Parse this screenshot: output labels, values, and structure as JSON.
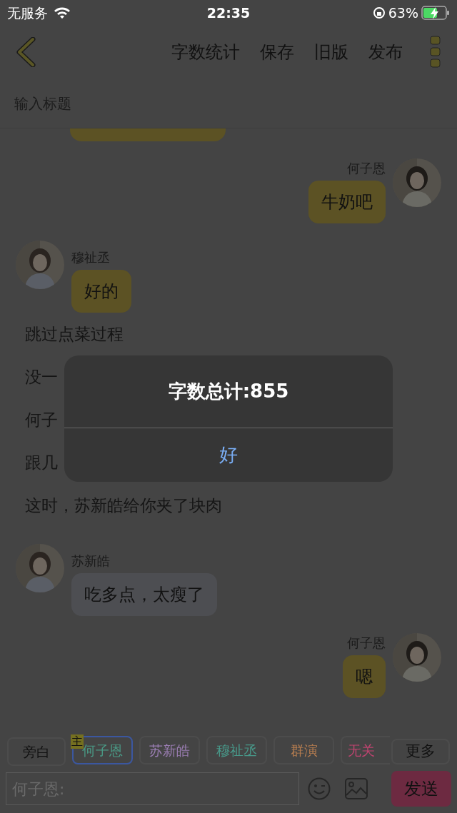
{
  "status_bar": {
    "carrier": "无服务",
    "time": "22:35",
    "battery_text": "63%"
  },
  "toolbar": {
    "actions": [
      "字数统计",
      "保存",
      "旧版",
      "发布"
    ]
  },
  "title_field": {
    "placeholder": "输入标题"
  },
  "messages": [
    {
      "kind": "fragment",
      "color": "#5c5224"
    },
    {
      "kind": "outgoing",
      "speaker": "何子恩",
      "text": "牛奶吧",
      "color": "#5c5224"
    },
    {
      "kind": "incoming",
      "speaker": "穆祉丞",
      "text": "好的",
      "color": "#5c5224"
    },
    {
      "kind": "narration",
      "text": "跳过点菜过程"
    },
    {
      "kind": "narration",
      "text": "没一"
    },
    {
      "kind": "narration",
      "text": "何子"
    },
    {
      "kind": "narration",
      "text": "跟几"
    },
    {
      "kind": "narration",
      "text": "这时，苏新皓给你夹了块肉"
    },
    {
      "kind": "incoming",
      "speaker": "苏新皓",
      "text": "吃多点，太瘦了",
      "color": "#4d4e52"
    },
    {
      "kind": "outgoing",
      "speaker": "何子恩",
      "text": "嗯",
      "color": "#5c5224"
    }
  ],
  "roles": [
    {
      "label": "旁白",
      "selected": false,
      "color": "#111111"
    },
    {
      "label": "何子恩",
      "selected": true,
      "color": "#4a9a86",
      "badge": "主"
    },
    {
      "label": "苏新皓",
      "selected": false,
      "color": "#9a7db2"
    },
    {
      "label": "穆祉丞",
      "selected": false,
      "color": "#48998a"
    },
    {
      "label": "群演",
      "selected": false,
      "color": "#b87e50"
    },
    {
      "label": "无关",
      "selected": false,
      "color": "#c04470"
    }
  ],
  "more_button": "更多",
  "input": {
    "placeholder": "何子恩:"
  },
  "send_button": "发送",
  "dialog": {
    "title": "字数总计:855",
    "button": "好"
  }
}
